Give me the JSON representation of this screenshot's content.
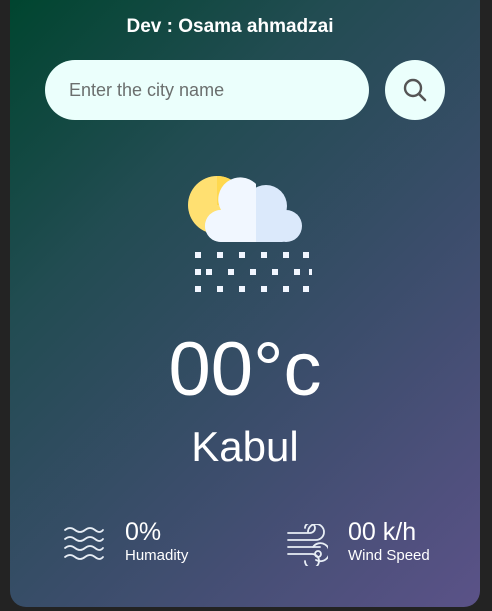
{
  "header": {
    "dev_label": "Dev : Osama ahmadzai"
  },
  "search": {
    "placeholder": "Enter the city name",
    "value": "",
    "button_icon": "search-icon"
  },
  "weather": {
    "icon": "partly-cloudy-snow-icon",
    "temperature": "00°c",
    "city": "Kabul"
  },
  "details": {
    "humidity": {
      "value": "0%",
      "label": "Humadity",
      "icon": "humidity-waves-icon"
    },
    "wind": {
      "value": "00 k/h",
      "label": "Wind Speed",
      "icon": "wind-icon"
    }
  },
  "colors": {
    "gradient_start": "#00452f",
    "gradient_end": "#5b5288",
    "input_bg": "#ebfffc",
    "page_bg": "#232323"
  }
}
